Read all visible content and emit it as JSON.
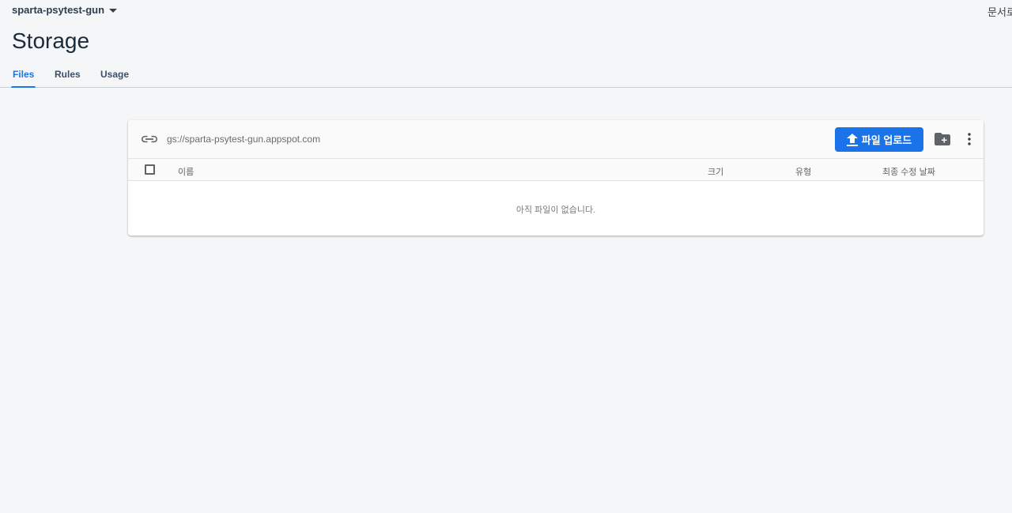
{
  "header": {
    "project_name": "sparta-psytest-gun",
    "docs_link": "문서로",
    "page_title": "Storage"
  },
  "tabs": [
    {
      "label": "Files",
      "active": true
    },
    {
      "label": "Rules",
      "active": false
    },
    {
      "label": "Usage",
      "active": false
    }
  ],
  "bucket": {
    "path": "gs://sparta-psytest-gun.appspot.com",
    "upload_label": "파일 업로드",
    "icons": [
      "link-icon",
      "upload-icon",
      "new-folder-icon",
      "more-vert-icon"
    ]
  },
  "table": {
    "columns": [
      "이름",
      "크기",
      "유형",
      "최종 수정 날짜"
    ],
    "empty_message": "아직 파일이 없습니다."
  },
  "colors": {
    "accent": "#1a73e8",
    "background": "#f5f6f8"
  }
}
